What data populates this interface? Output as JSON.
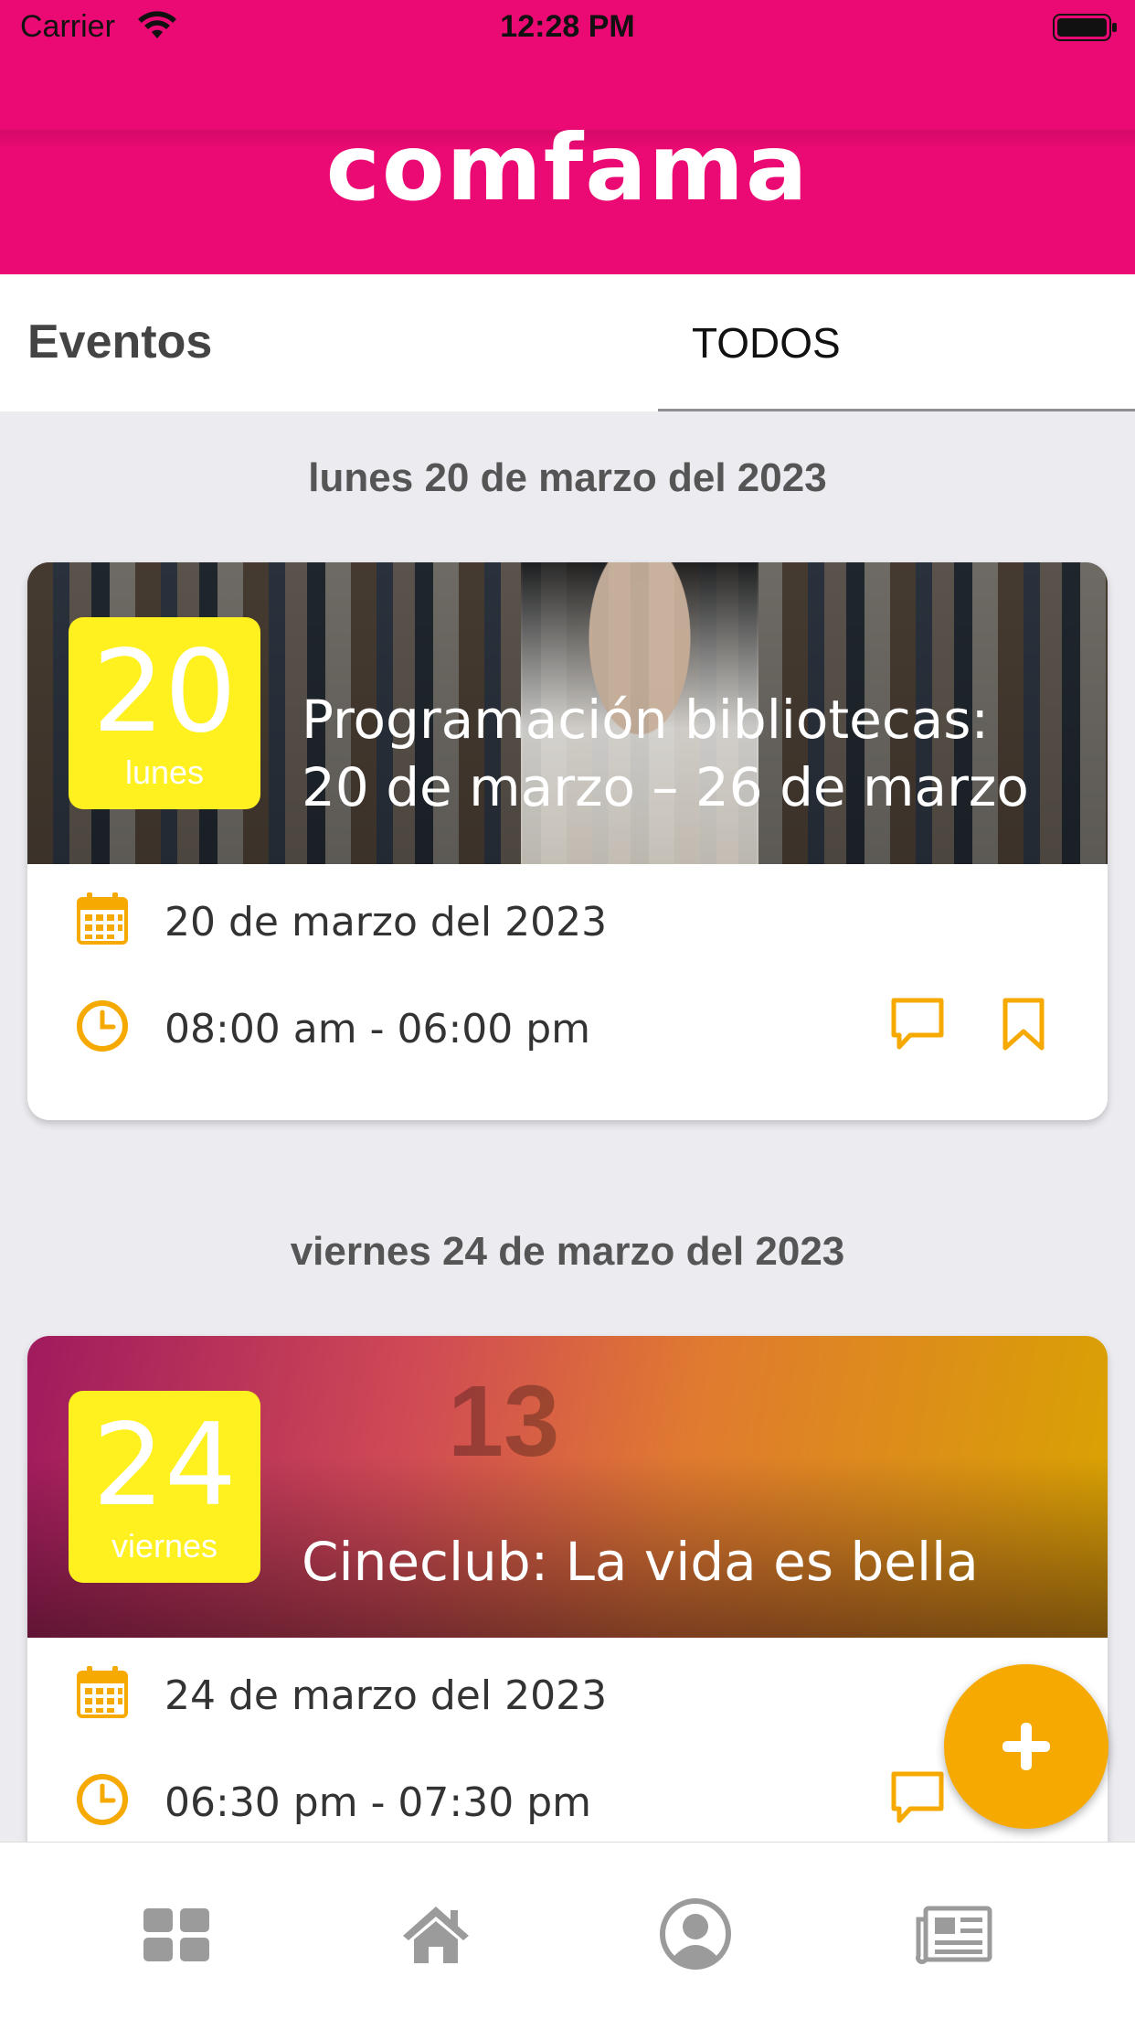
{
  "status_bar": {
    "carrier": "Carrier",
    "time": "12:28 PM"
  },
  "header": {
    "logo": "comfama",
    "brand_color": "#eb0a73"
  },
  "tabs": {
    "title": "Eventos",
    "selected_tab": "TODOS"
  },
  "sections": [
    {
      "date_heading": "lunes 20 de marzo del 2023",
      "event": {
        "badge_day": "20",
        "badge_weekday": "lunes",
        "title": "Programación bibliotecas: 20 de marzo – 26 de marzo",
        "date": "20 de marzo del 2023",
        "time": "08:00 am - 06:00 pm"
      }
    },
    {
      "date_heading": "viernes 24 de marzo del 2023",
      "event": {
        "badge_day": "24",
        "badge_weekday": "viernes",
        "title": "Cineclub: La vida es bella",
        "date": "24 de marzo del 2023",
        "time": "06:30 pm - 07:30 pm"
      }
    }
  ],
  "colors": {
    "accent": "#f6a900",
    "badge": "#fff01f",
    "icon_gray": "#9b9b9b"
  },
  "icons": {
    "card_actions": [
      "comment-icon",
      "bookmark-icon"
    ],
    "fab": "plus-icon",
    "bottom_nav": [
      "grid-icon",
      "home-icon",
      "profile-icon",
      "news-icon"
    ]
  }
}
